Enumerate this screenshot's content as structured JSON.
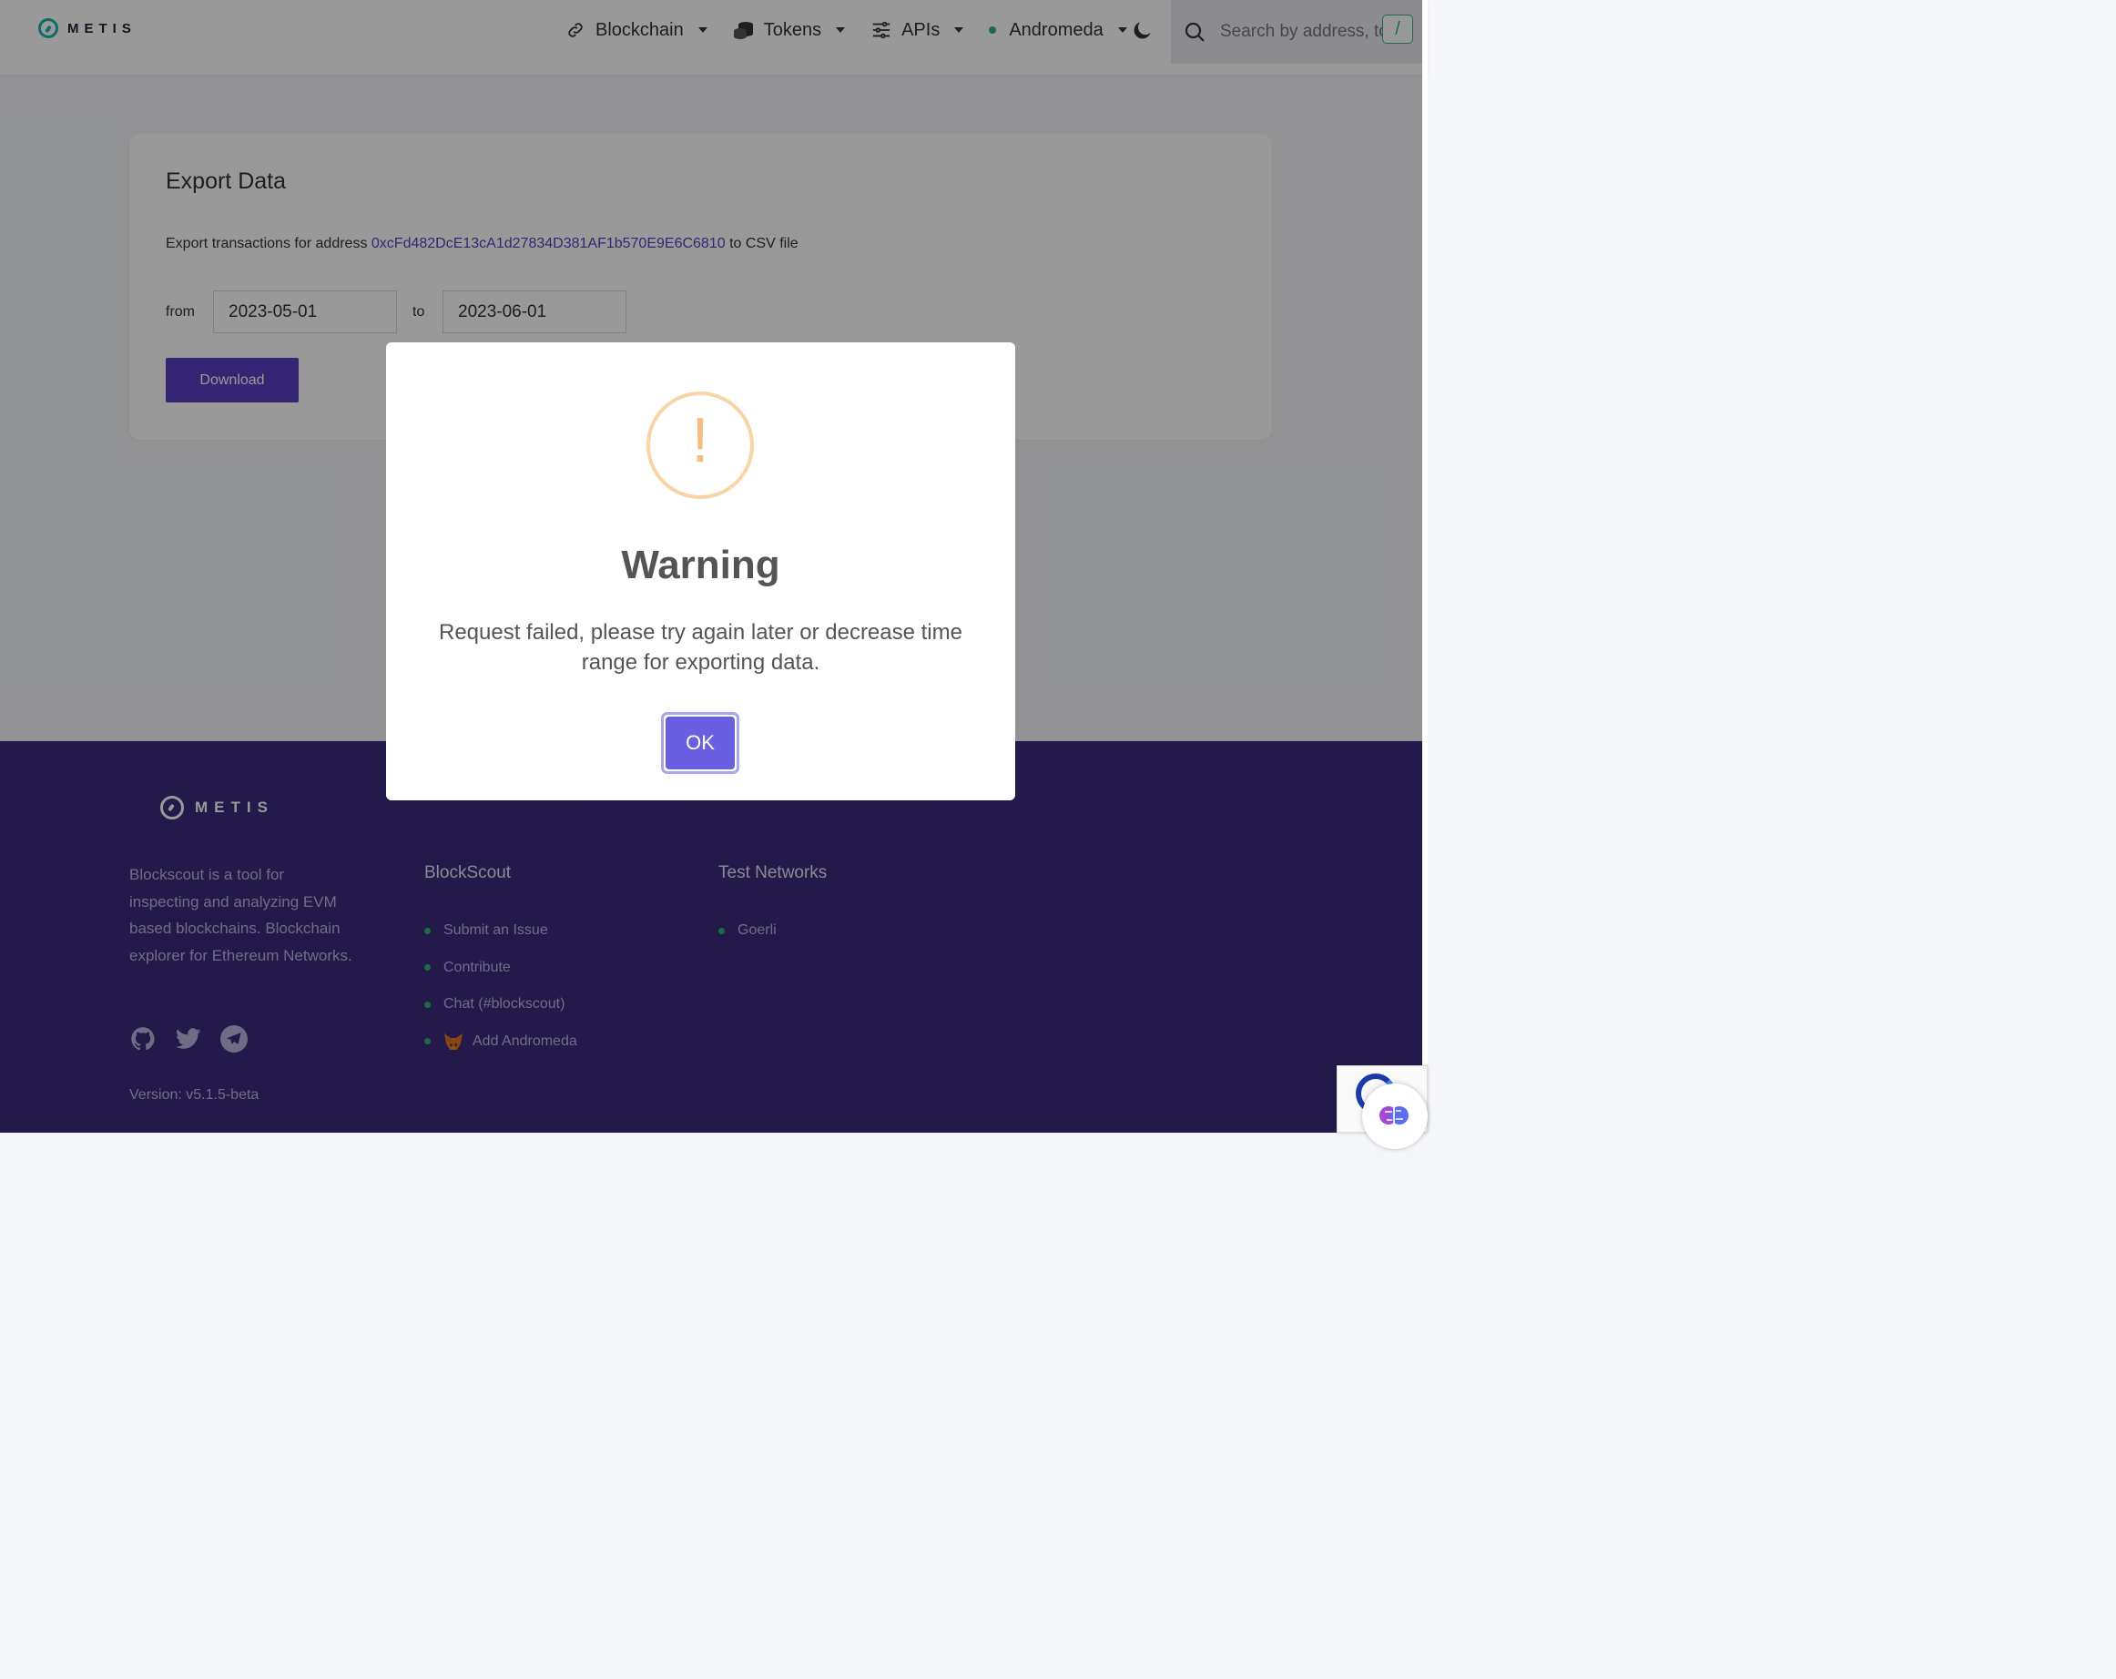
{
  "header": {
    "logo_text": "METIS",
    "nav": [
      {
        "label": "Blockchain",
        "icon": "link-icon"
      },
      {
        "label": "Tokens",
        "icon": "coins-icon"
      },
      {
        "label": "APIs",
        "icon": "sliders-icon"
      },
      {
        "label": "Andromeda",
        "icon": "network-dot"
      }
    ],
    "search_placeholder": "Search by address, to",
    "search_shortcut": "/"
  },
  "export": {
    "title": "Export Data",
    "line_prefix": "Export transactions for address",
    "address": "0xcFd482DcE13cA1d27834D381AF1b570E9E6C6810",
    "line_suffix": "to CSV file",
    "from_label": "from",
    "from_value": "2023-05-01",
    "to_label": "to",
    "to_value": "2023-06-01",
    "download_label": "Download"
  },
  "modal": {
    "icon": "!",
    "title": "Warning",
    "message": "Request failed, please try again later or decrease time range for exporting data.",
    "ok_label": "OK"
  },
  "footer": {
    "logo_text": "METIS",
    "description": "Blockscout is a tool for inspecting and analyzing EVM based blockchains. Blockchain explorer for Ethereum Networks.",
    "columns": [
      {
        "title": "BlockScout",
        "items": [
          "Submit an Issue",
          "Contribute",
          "Chat (#blockscout)",
          "Add Andromeda"
        ]
      },
      {
        "title": "Test Networks",
        "items": [
          "Goerli"
        ]
      }
    ],
    "version": "Version: v5.1.5-beta"
  },
  "colors": {
    "accent": "#5b3cc4",
    "footer_bg": "#3b2a7e",
    "ok_button": "#6a5fe0",
    "warning": "#f4bd84",
    "status_green": "#2fb36f"
  }
}
